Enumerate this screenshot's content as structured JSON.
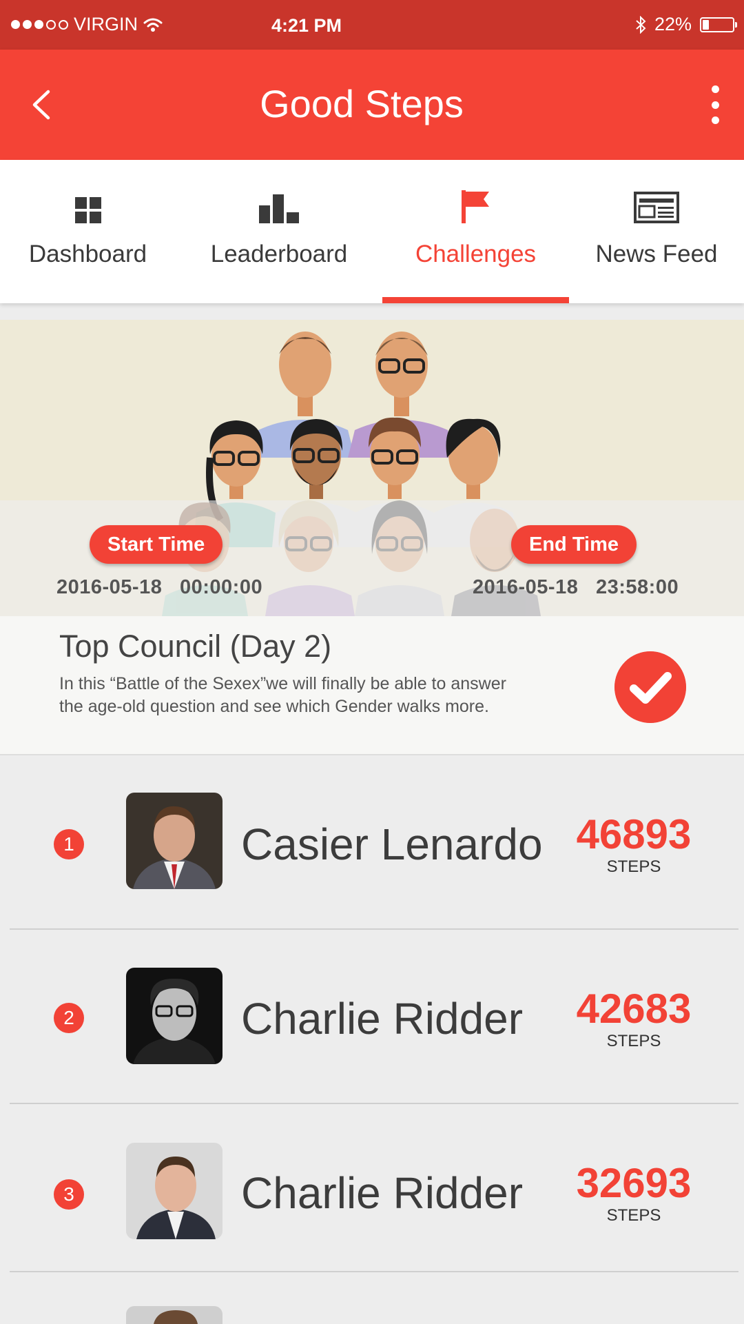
{
  "status_bar": {
    "carrier": "VIRGIN",
    "time": "4:21 PM",
    "battery": "22%",
    "battery_level": 0.22,
    "signal_bars": 3,
    "signal_total": 5
  },
  "app_bar": {
    "title": "Good Steps",
    "back_icon": "chevron-left-icon",
    "menu_icon": "more-vertical-icon"
  },
  "tabs": [
    {
      "label": "Dashboard",
      "icon": "grid-icon",
      "active": false
    },
    {
      "label": "Leaderboard",
      "icon": "bar-chart-icon",
      "active": false
    },
    {
      "label": "Challenges",
      "icon": "flag-icon",
      "active": true
    },
    {
      "label": "News Feed",
      "icon": "newspaper-icon",
      "active": false
    }
  ],
  "challenge": {
    "start_label": "Start Time",
    "start_value": "2016-05-18   00:00:00",
    "end_label": "End Time",
    "end_value": "2016-05-18   23:58:00",
    "title": "Top Council (Day 2)",
    "description": "In this “Battle of the Sexex”we will finally be able to answer the age-old question and see which Gender walks more.",
    "completed": true
  },
  "leaderboard": [
    {
      "rank": "1",
      "name": "Casier Lenardo",
      "steps": "46893",
      "unit": "STEPS"
    },
    {
      "rank": "2",
      "name": "Charlie Ridder",
      "steps": "42683",
      "unit": "STEPS"
    },
    {
      "rank": "3",
      "name": "Charlie Ridder",
      "steps": "32693",
      "unit": "STEPS"
    }
  ],
  "colors": {
    "primary": "#f44336",
    "status_bar": "#c9352b",
    "banner_bg": "#eeead7",
    "list_bg": "#ededed"
  }
}
